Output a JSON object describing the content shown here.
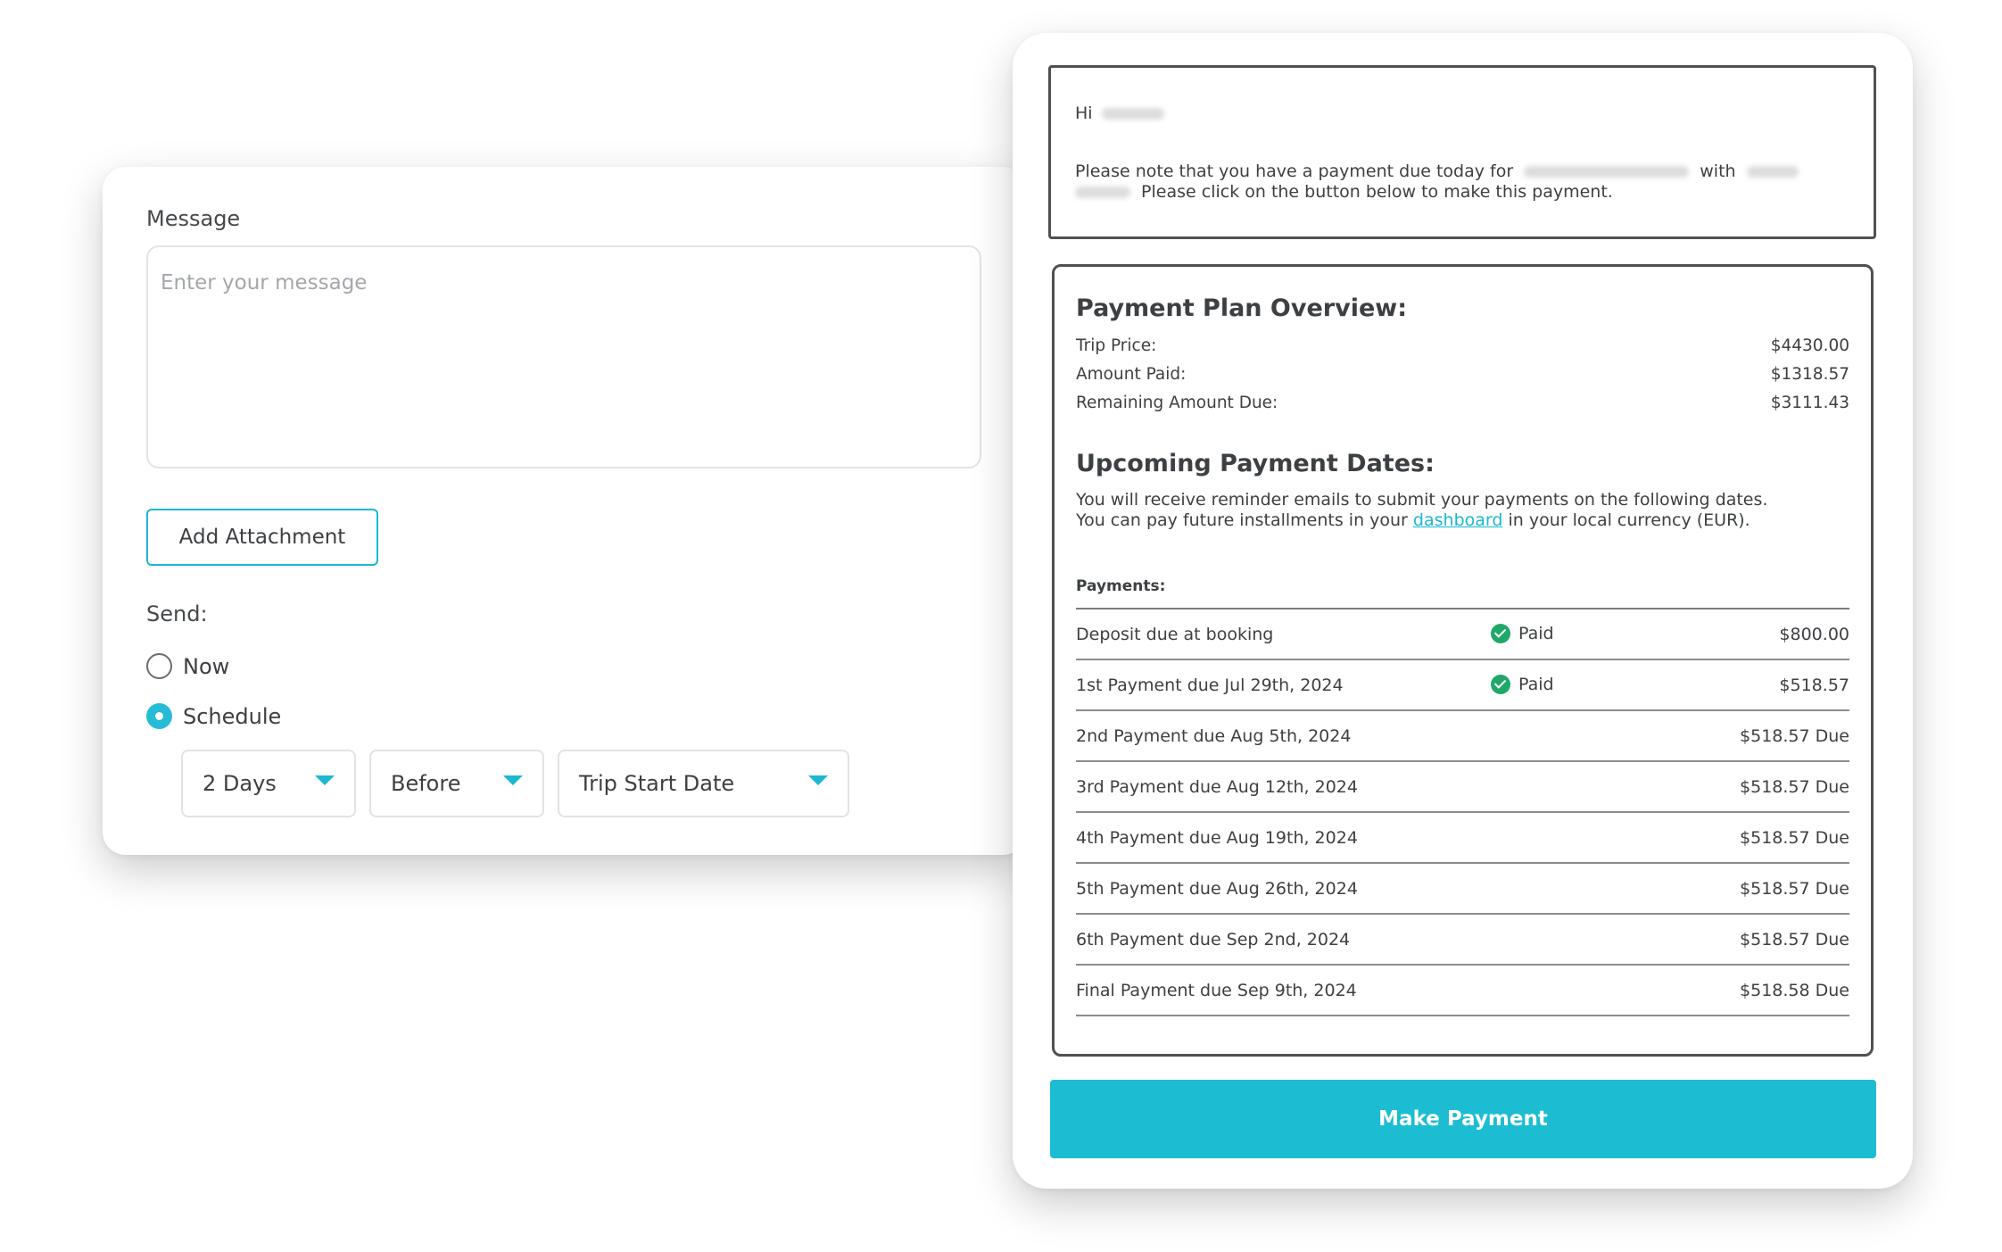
{
  "composer": {
    "message_label": "Message",
    "message_placeholder": "Enter your message",
    "attachment_button": "Add Attachment",
    "send_label": "Send:",
    "options": {
      "now": "Now",
      "schedule": "Schedule"
    },
    "selected_option": "Schedule",
    "schedule": {
      "amount": "2 Days",
      "relation": "Before",
      "reference": "Trip Start Date"
    }
  },
  "email": {
    "greeting": "Hi",
    "line1_start": "Please note that you have a payment due today for",
    "line1_mid": "with",
    "line2_end": "Please click on the button below to make this payment.",
    "overview": {
      "title": "Payment Plan Overview:",
      "items": [
        {
          "label": "Trip Price:",
          "value": "$4430.00"
        },
        {
          "label": "Amount Paid:",
          "value": "$1318.57"
        },
        {
          "label": "Remaining Amount Due:",
          "value": "$3111.43"
        }
      ]
    },
    "upcoming": {
      "title": "Upcoming Payment Dates:",
      "line1": "You will receive reminder emails to submit your payments on the following dates.",
      "line2_before": "You can pay future installments in your",
      "link": "dashboard",
      "line2_after": "in your local currency (EUR)."
    },
    "payments_header": "Payments:",
    "payments": [
      {
        "label": "Deposit due at booking",
        "status": "Paid",
        "amount": "$800.00"
      },
      {
        "label": "1st Payment due Jul 29th, 2024",
        "status": "Paid",
        "amount": "$518.57"
      },
      {
        "label": "2nd Payment due Aug 5th, 2024",
        "status": "",
        "amount": "$518.57 Due"
      },
      {
        "label": "3rd Payment due Aug 12th, 2024",
        "status": "",
        "amount": "$518.57 Due"
      },
      {
        "label": "4th Payment due Aug 19th, 2024",
        "status": "",
        "amount": "$518.57 Due"
      },
      {
        "label": "5th Payment due Aug 26th, 2024",
        "status": "",
        "amount": "$518.57 Due"
      },
      {
        "label": "6th Payment due Sep 2nd, 2024",
        "status": "",
        "amount": "$518.57 Due"
      },
      {
        "label": "Final Payment due Sep 9th, 2024",
        "status": "",
        "amount": "$518.58 Due"
      }
    ],
    "make_payment_button": "Make Payment"
  },
  "colors": {
    "accent": "#1cbdd3",
    "paid_check": "#1fa86a",
    "border_dark": "#4d5154"
  },
  "icons": {
    "paid": "check-circle-icon",
    "dropdown": "caret-down-icon"
  }
}
